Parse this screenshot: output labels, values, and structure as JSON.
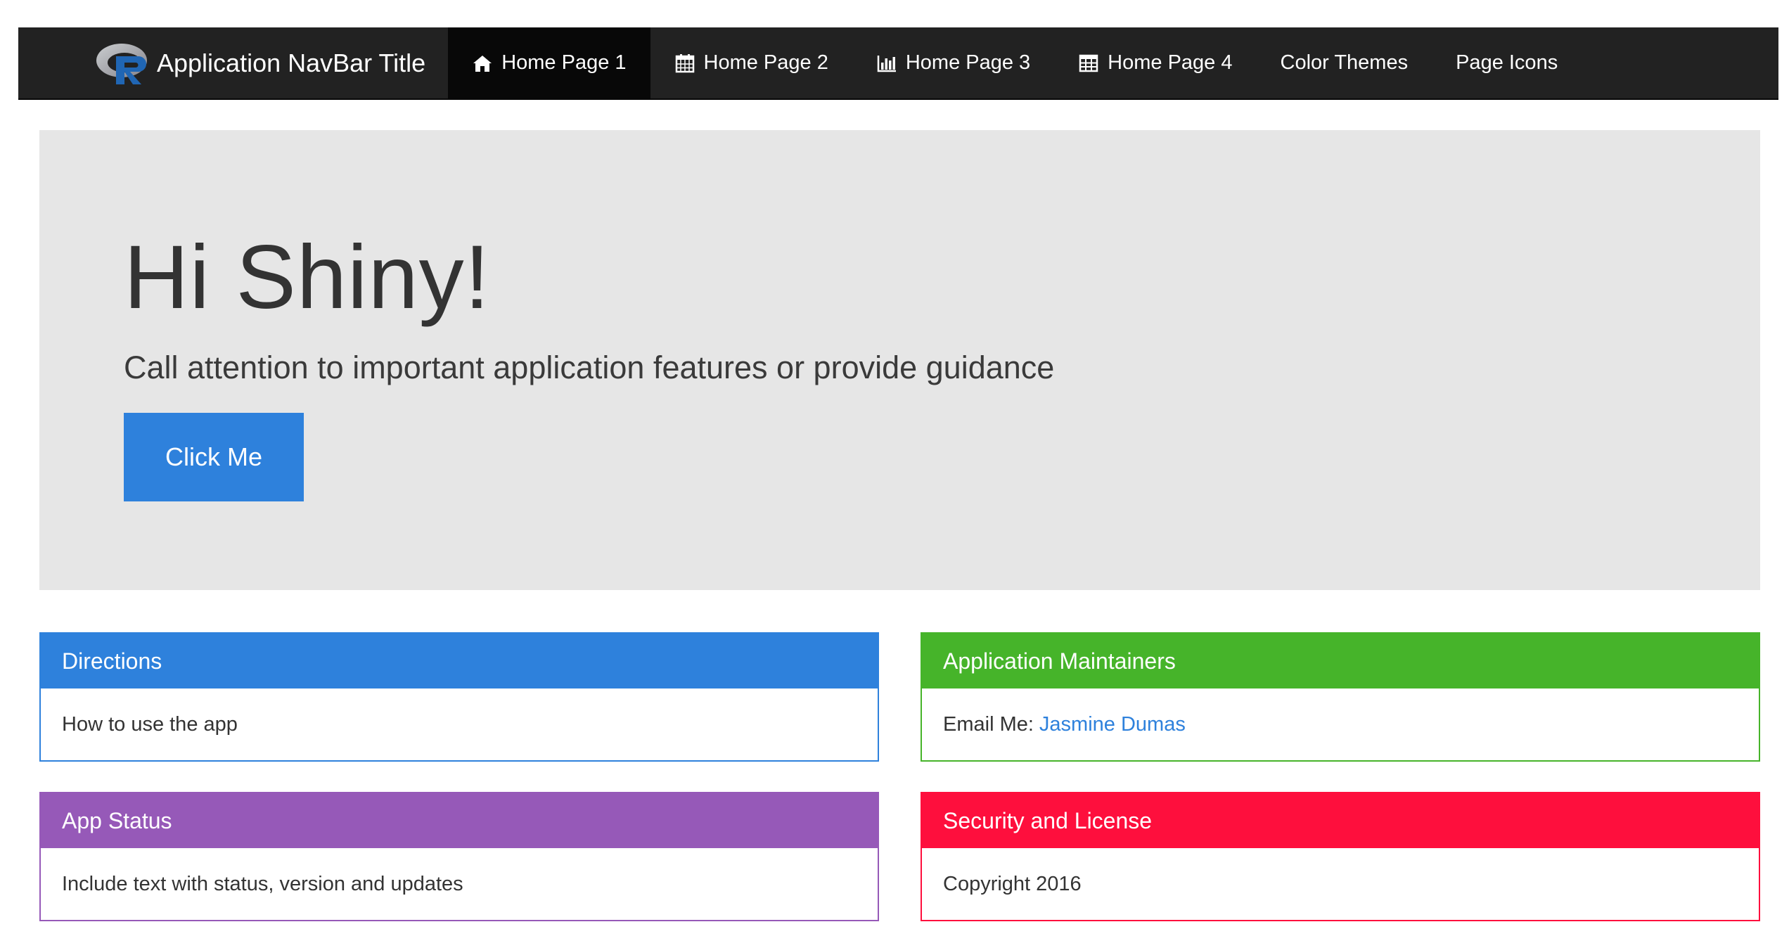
{
  "navbar": {
    "brand_logo": "R-logo",
    "title": "Application NavBar Title",
    "background": "#222222",
    "active_background": "#080808",
    "items": [
      {
        "label": "Home Page 1",
        "icon": "home-icon",
        "active": true
      },
      {
        "label": "Home Page 2",
        "icon": "calendar-icon",
        "active": false
      },
      {
        "label": "Home Page 3",
        "icon": "bar-chart-icon",
        "active": false
      },
      {
        "label": "Home Page 4",
        "icon": "table-icon",
        "active": false
      },
      {
        "label": "Color Themes",
        "icon": "",
        "active": false
      },
      {
        "label": "Page Icons",
        "icon": "",
        "active": false
      }
    ]
  },
  "jumbotron": {
    "title": "Hi Shiny!",
    "subtitle": "Call attention to important application features or provide guidance",
    "button_label": "Click Me",
    "background": "#e6e6e6",
    "button_color": "#2e81dc"
  },
  "panels": {
    "directions": {
      "heading": "Directions",
      "body": "How to use the app",
      "color": "#2e81dc"
    },
    "maintainers": {
      "heading": "Application Maintainers",
      "body_prefix": "Email Me:",
      "link_text": "Jasmine Dumas",
      "color": "#46b42a"
    },
    "status": {
      "heading": "App Status",
      "body": "Include text with status, version and updates",
      "color": "#9659b8"
    },
    "security": {
      "heading": "Security and License",
      "body": "Copyright 2016",
      "color": "#fe0f3d"
    }
  }
}
